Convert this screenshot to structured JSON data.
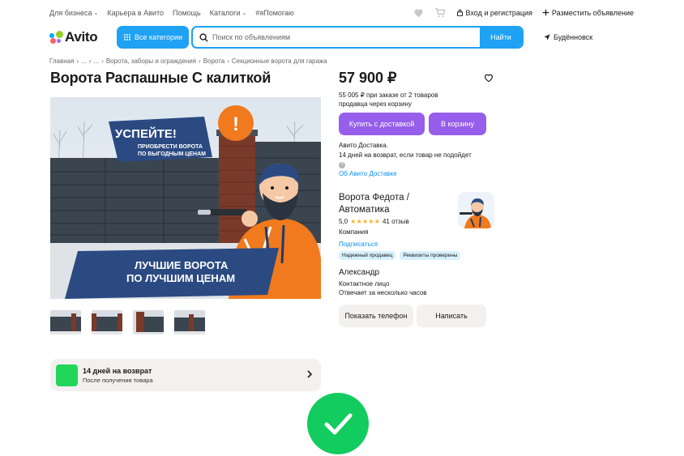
{
  "topbar": {
    "links": [
      {
        "label": "Для бизнеса",
        "dropdown": true
      },
      {
        "label": "Карьера в Авито",
        "dropdown": false
      },
      {
        "label": "Помощь",
        "dropdown": false
      },
      {
        "label": "Каталоги",
        "dropdown": true
      },
      {
        "label": "#яПомогаю",
        "dropdown": false
      }
    ],
    "login_label": "Вход и регистрация",
    "post_ad_label": "Разместить объявление",
    "icons": [
      "heart-icon",
      "cart-icon",
      "lock-icon",
      "plus-icon"
    ]
  },
  "header": {
    "logo_text": "Avito",
    "logo_colors": [
      "#00aaff",
      "#97cf26",
      "#ff6163",
      "#a169f7"
    ],
    "categories_label": "Все категории",
    "search_placeholder": "Поиск по объявлениям",
    "search_button": "Найти",
    "location": "Будённовск"
  },
  "breadcrumb": [
    "Главная",
    "...",
    "...",
    "Ворота, заборы и ограждения",
    "Ворота",
    "Секционные ворота для гаража"
  ],
  "listing": {
    "title": "Ворота Распашные С калиткой",
    "image": {
      "banner_top": "УСПЕЙТЕ!",
      "banner_sub1": "ПРИОБРЕСТИ ВОРОТА",
      "banner_sub2": "ПО ВЫГОДНЫМ ЦЕНАМ",
      "exclaim": "!",
      "banner_bottom1": "ЛУЧШИЕ ВОРОТА",
      "banner_bottom2": "ПО ЛУЧШИМ ЦЕНАМ"
    },
    "thumbnail_count": 4,
    "return_card": {
      "title": "14 дней на возврат",
      "subtitle": "После получения товара"
    }
  },
  "sidebar": {
    "price": "57 900 ₽",
    "bulk_line1": "55 005 ₽ при заказе от 2 товаров",
    "bulk_line2": "продавца через корзину",
    "buy_delivery": "Купить с доставкой",
    "to_cart": "В корзину",
    "delivery_line1": "Авито Доставка.",
    "delivery_line2": "14 дней на возврат, если товар не подойдет",
    "delivery_link": "Об Авито Доставке",
    "seller_name": "Ворота Федота / Автоматика",
    "rating_value": "5,0",
    "rating_stars": "★★★★★",
    "reviews": "41 отзыв",
    "seller_type": "Компания",
    "subscribe": "Подписаться",
    "badges": [
      "Надежный продавец",
      "Реквизиты проверены"
    ],
    "contact_name": "Александр",
    "contact_type": "Контактное лицо",
    "contact_reply": "Отвечает за несколько часов",
    "show_phone": "Показать телефон",
    "write": "Написать"
  },
  "colors": {
    "accent_blue": "#1fa1f4",
    "purple": "#965eeb",
    "link_blue": "#0a8ff5",
    "success_green": "#13cc5f",
    "card_gray": "#f2f1f0"
  }
}
